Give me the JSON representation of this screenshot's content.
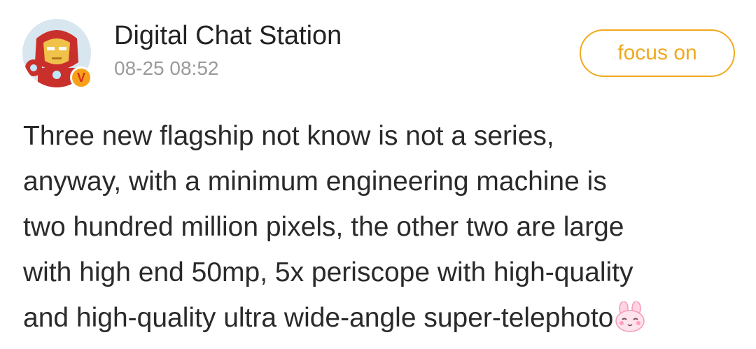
{
  "post": {
    "author": {
      "name": "Digital Chat Station",
      "verified_mark": "V"
    },
    "timestamp": "08-25 08:52",
    "follow_label": "focus on",
    "text_lines": [
      "Three new flagship not know is not a series,",
      "anyway, with a minimum engineering machine is",
      "two hundred million pixels, the other two are large",
      "with high end 50mp, 5x periscope with high-quality",
      "and high-quality ultra wide-angle super-telephoto"
    ],
    "trailing_emoji": "bunny-emoji"
  },
  "colors": {
    "accent": "#f0a91e",
    "text": "#2a2a2a",
    "meta": "#9a9a9a",
    "badge": "#f5a21a"
  }
}
